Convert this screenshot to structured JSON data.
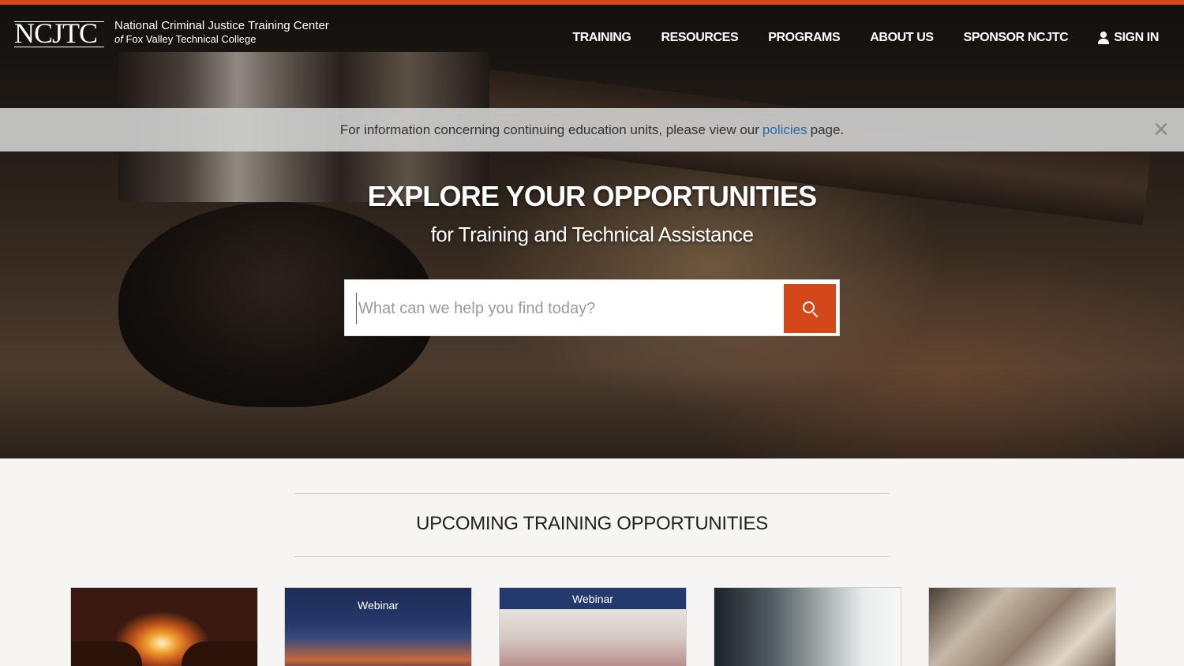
{
  "header": {
    "logo_text": "NCJTC",
    "org_name": "National Criminal Justice Training Center",
    "org_sub_prefix": "of",
    "org_sub": "Fox Valley Technical College"
  },
  "nav": {
    "items": [
      {
        "label": "TRAINING"
      },
      {
        "label": "RESOURCES"
      },
      {
        "label": "PROGRAMS"
      },
      {
        "label": "ABOUT US"
      },
      {
        "label": "SPONSOR NCJTC"
      }
    ],
    "sign_in": "SIGN IN",
    "sign_in_icon": "user-icon"
  },
  "notice": {
    "text_before": "For information concerning continuing education units, please view our",
    "link": "policies",
    "text_after": "page.",
    "close": "✕"
  },
  "hero": {
    "title": "EXPLORE YOUR OPPORTUNITIES",
    "subtitle": "for Training and Technical Assistance"
  },
  "search": {
    "placeholder": "What can we help you find today?",
    "value": "",
    "button_icon": "search-icon"
  },
  "upcoming": {
    "title": "UPCOMING TRAINING OPPORTUNITIES",
    "cards": [
      {
        "badge": ""
      },
      {
        "badge": "Webinar"
      },
      {
        "badge": "Webinar"
      },
      {
        "badge": ""
      },
      {
        "badge": ""
      }
    ]
  },
  "colors": {
    "accent": "#d4471a",
    "link": "#2c6aa8",
    "notice_bg": "#cdcdcd"
  }
}
